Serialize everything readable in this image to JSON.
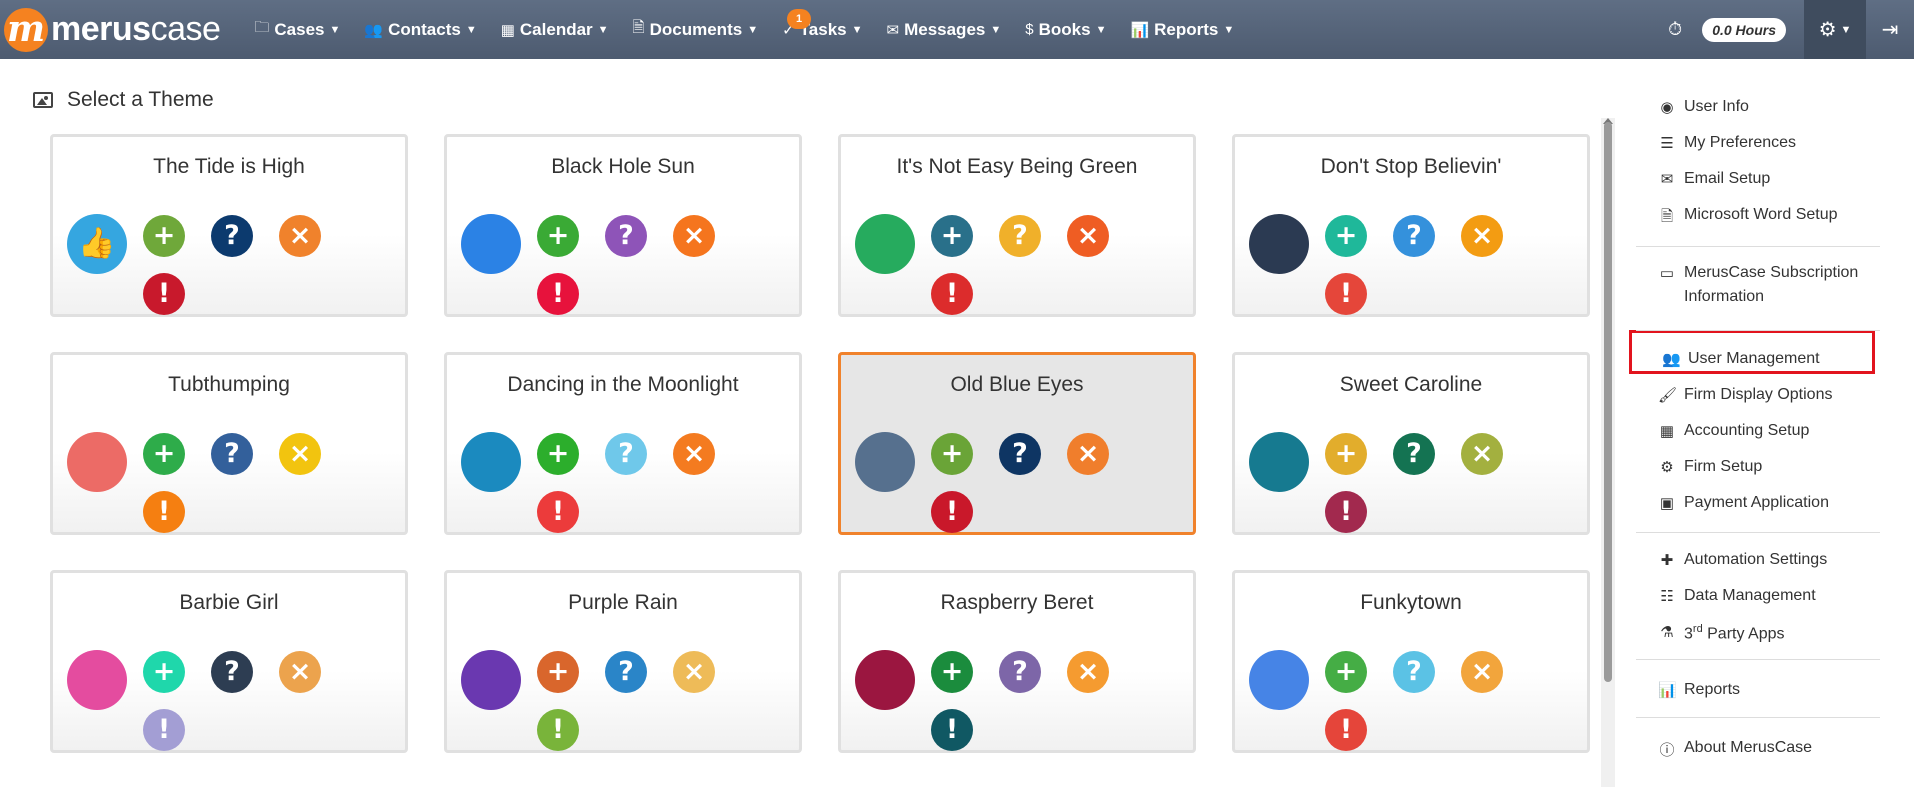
{
  "brand": {
    "logo_letter": "m",
    "name_bold": "merus",
    "name_light": "case"
  },
  "nav": [
    {
      "icon": "folder-icon",
      "glyph": "🗀",
      "label": "Cases"
    },
    {
      "icon": "contacts-icon",
      "glyph": "👥",
      "label": "Contacts"
    },
    {
      "icon": "calendar-icon",
      "glyph": "▦",
      "label": "Calendar"
    },
    {
      "icon": "document-icon",
      "glyph": "🗎",
      "label": "Documents"
    },
    {
      "icon": "tasks-icon",
      "glyph": "✓",
      "label": "Tasks",
      "badge": "1"
    },
    {
      "icon": "envelope-icon",
      "glyph": "✉",
      "label": "Messages"
    },
    {
      "icon": "dollar-icon",
      "glyph": "$",
      "label": "Books"
    },
    {
      "icon": "bar-chart-icon",
      "glyph": "📊",
      "label": "Reports"
    }
  ],
  "topright": {
    "hours": "0.0 Hours"
  },
  "page": {
    "title": "Select a Theme"
  },
  "themes": [
    {
      "name": "The Tide is High",
      "main": "#35a6e0",
      "thumb": true,
      "plus": "#6fa83a",
      "question": "#0c3a6e",
      "close": "#f0822c",
      "alert": "#c8192c"
    },
    {
      "name": "Black Hole Sun",
      "main": "#2b82e5",
      "plus": "#3aaa35",
      "question": "#8e54b8",
      "close": "#f5751e",
      "alert": "#e7123c"
    },
    {
      "name": "It's Not Easy Being Green",
      "main": "#26ab5e",
      "plus": "#29708a",
      "question": "#f0b02a",
      "close": "#ef5d23",
      "alert": "#dc2c2c"
    },
    {
      "name": "Don't Stop Believin'",
      "main": "#2b3a52",
      "plus": "#1fb89a",
      "question": "#3491dc",
      "close": "#f39c12",
      "alert": "#e5463a"
    },
    {
      "name": "Tubthumping",
      "main": "#ec6b66",
      "plus": "#2eac4a",
      "question": "#33609b",
      "close": "#f2c40f",
      "alert": "#f57f11"
    },
    {
      "name": "Dancing in the Moonlight",
      "main": "#1b8abf",
      "plus": "#2cae2c",
      "question": "#6fc8ea",
      "close": "#f47b20",
      "alert": "#ec3b3b"
    },
    {
      "name": "Old Blue Eyes",
      "main": "#56708e",
      "plus": "#6aa437",
      "question": "#0e3563",
      "close": "#f07e2c",
      "alert": "#c9182a",
      "selected": true
    },
    {
      "name": "Sweet Caroline",
      "main": "#167a90",
      "plus": "#e2ad2c",
      "question": "#147352",
      "close": "#a3b03f",
      "alert": "#a2294e"
    },
    {
      "name": "Barbie Girl",
      "main": "#e44c9f",
      "plus": "#1fd7ab",
      "question": "#2d3d52",
      "close": "#eca34d",
      "alert": "#a39ed4"
    },
    {
      "name": "Purple Rain",
      "main": "#6a38b0",
      "plus": "#d9662c",
      "question": "#2a85c8",
      "close": "#eebb58",
      "alert": "#79b43a"
    },
    {
      "name": "Raspberry Beret",
      "main": "#9b1640",
      "plus": "#1b8c3d",
      "question": "#7d66a8",
      "close": "#f59b30",
      "alert": "#105863"
    },
    {
      "name": "Funkytown",
      "main": "#4684e6",
      "plus": "#45ad45",
      "question": "#5bc2e5",
      "close": "#f2a53c",
      "alert": "#e5453a"
    }
  ],
  "sidebar": {
    "items": [
      {
        "icon": "user-circle-icon",
        "glyph": "◉",
        "label": "User Info"
      },
      {
        "icon": "sliders-icon",
        "glyph": "☰",
        "label": "My Preferences"
      },
      {
        "icon": "envelope-icon",
        "glyph": "✉",
        "label": "Email Setup"
      },
      {
        "icon": "word-file-icon",
        "glyph": "🗎",
        "label": "Microsoft Word Setup"
      },
      {
        "icon": "credit-card-icon",
        "glyph": "▭",
        "label": "MerusCase Subscription Information"
      },
      {
        "icon": "users-icon",
        "glyph": "👥",
        "label": "User Management"
      },
      {
        "icon": "paint-brush-icon",
        "glyph": "🖌",
        "label": "Firm Display Options"
      },
      {
        "icon": "calculator-icon",
        "glyph": "▦",
        "label": "Accounting Setup"
      },
      {
        "icon": "cogs-icon",
        "glyph": "⚙",
        "label": "Firm Setup"
      },
      {
        "icon": "money-icon",
        "glyph": "▣",
        "label": "Payment Application"
      },
      {
        "icon": "puzzle-icon",
        "glyph": "✚",
        "label": "Automation Settings"
      },
      {
        "icon": "database-icon",
        "glyph": "☷",
        "label": "Data Management"
      },
      {
        "icon": "flask-icon",
        "glyph": "⚗",
        "label_pre": "3",
        "label_sup": "rd",
        "label": " Party Apps"
      },
      {
        "icon": "bar-chart-icon",
        "glyph": "📊",
        "label": "Reports"
      },
      {
        "icon": "info-icon",
        "glyph": "ⓘ",
        "label": "About MerusCase"
      }
    ]
  }
}
